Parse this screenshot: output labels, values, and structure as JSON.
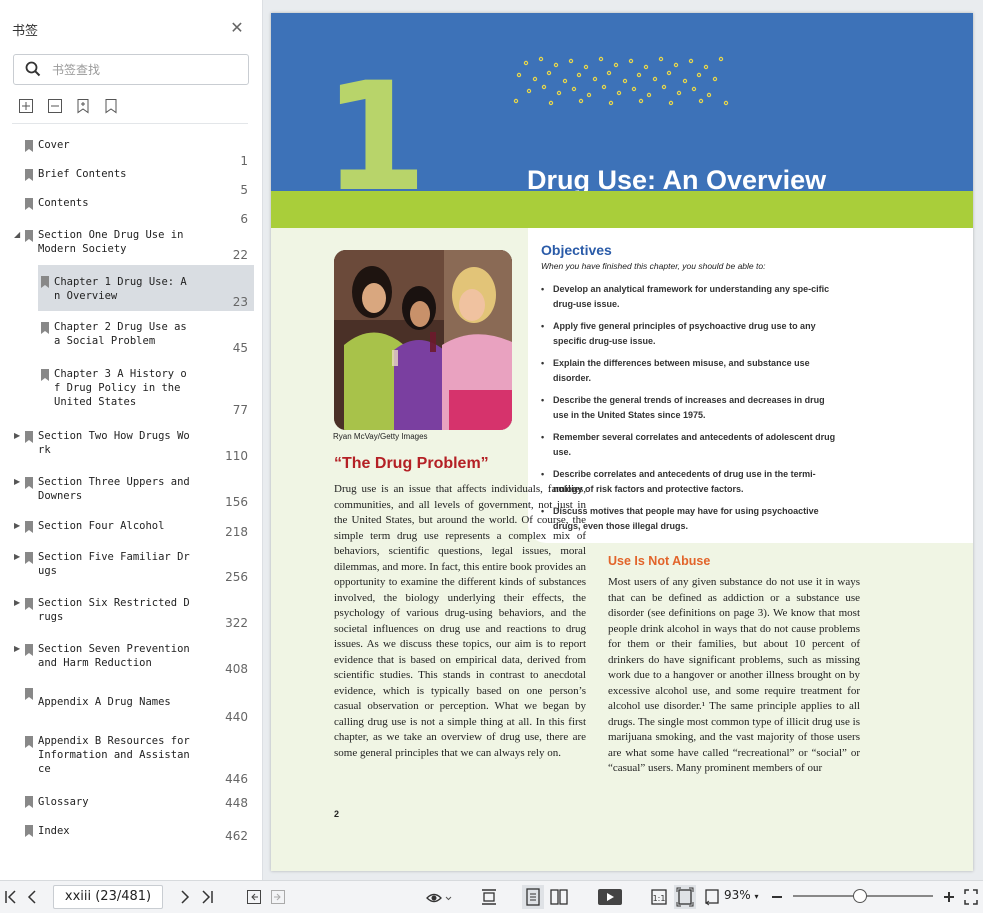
{
  "sidebar": {
    "title": "书签",
    "search_placeholder": "书签查找",
    "items": [
      {
        "label": "Cover",
        "page": "1",
        "expandable": false
      },
      {
        "label": "Brief Contents",
        "page": "5",
        "expandable": false
      },
      {
        "label": "Contents",
        "page": "6",
        "expandable": false
      },
      {
        "label": "Section One Drug Use in\nModern Society",
        "page": "22",
        "expandable": true,
        "expanded": true
      },
      {
        "label": "Chapter 1 Drug Use: A\nn Overview",
        "page": "23",
        "expandable": false,
        "child": true,
        "active": true
      },
      {
        "label": "Chapter 2 Drug Use as\na Social Problem",
        "page": "45",
        "expandable": false,
        "child": true
      },
      {
        "label": "Chapter 3 A History o\nf Drug Policy in the\nUnited States",
        "page": "77",
        "expandable": false,
        "child": true
      },
      {
        "label": "Section Two How Drugs Wo\nrk",
        "page": "110",
        "expandable": true
      },
      {
        "label": "Section Three Uppers and\nDowners",
        "page": "156",
        "expandable": true
      },
      {
        "label": "Section Four Alcohol",
        "page": "218",
        "expandable": true
      },
      {
        "label": "Section Five Familiar Dr\nugs",
        "page": "256",
        "expandable": true
      },
      {
        "label": "Section Six Restricted D\nrugs",
        "page": "322",
        "expandable": true
      },
      {
        "label": "Section Seven Prevention\nand Harm Reduction",
        "page": "408",
        "expandable": true
      },
      {
        "label": "Appendix A Drug Names",
        "page": "440",
        "expandable": false
      },
      {
        "label": "Appendix B Resources for\nInformation and Assistan\nce",
        "page": "446",
        "expandable": false
      },
      {
        "label": "Glossary",
        "page": "448",
        "expandable": false
      },
      {
        "label": "Index",
        "page": "462",
        "expandable": false
      }
    ]
  },
  "page": {
    "chapter_number": "1",
    "chapter_title": "Drug Use: An Overview",
    "objectives_title": "Objectives",
    "objectives_sub": "When you have finished this chapter, you should be able to:",
    "objectives": [
      "Develop an analytical framework for understanding any spe-cific drug-use issue.",
      "Apply five general principles of psychoactive drug use to any specific drug-use issue.",
      "Explain the differences between misuse, and substance use disorder.",
      "Describe the general trends of increases and decreases in drug use in the United States since 1975.",
      "Remember several correlates and antecedents of adolescent drug use.",
      "Describe correlates and antecedents of drug use in the termi-nology of risk factors and protective factors.",
      "Discuss motives that people may have for using psychoactive drugs, even those illegal drugs."
    ],
    "photo_credit": "Ryan McVay/Getty Images",
    "section_heading": "“The Drug Problem”",
    "body_left": "Drug use is an issue that affects individuals, families, communities, and all levels of government, not just in the United States, but around the world. Of course, the simple term drug use represents a complex mix of behaviors, scientific questions, legal issues, moral dilemmas, and more. In fact, this entire book provides an opportunity to examine the different kinds of substances involved, the biology underlying their effects, the psychology of various drug-using behaviors, and the societal influences on drug use and reactions to drug issues. As we discuss these topics, our aim is to report evidence that is based on empirical data, derived from scientific studies. This stands in contrast to anecdotal evidence, which is typically based on one person’s casual observation or perception. What we began by calling drug use is not a simple thing at all. In this first chapter, as we take an overview of drug use, there are some general principles that we can always rely on.",
    "right_heading": "Use Is Not Abuse",
    "body_right": "Most users of any given substance do not use it in ways that can be defined as addiction or a substance use disorder (see definitions on page 3). We know that most people drink alcohol in ways that do not cause problems for them or their families, but about 10 percent of drinkers do have significant problems, such as missing work due to a hangover or another illness brought on by excessive alcohol use, and some require treatment for alcohol use disorder.¹ The same principle applies to all drugs. The single most common type of illicit drug use is marijuana smoking, and the vast majority of those users are what some have called “recreational” or “social” or “casual” users. Many prominent members of our",
    "page_number": "2"
  },
  "statusbar": {
    "page_field": "xxiii (23/481)",
    "zoom": "93%",
    "zoom_level": 0.47
  },
  "colors": {
    "banner": "#3d72b8",
    "band": "#a9ce3a",
    "heading_red": "#b42025",
    "heading_orange": "#e2642a",
    "objectives_blue": "#2a5ba8"
  }
}
